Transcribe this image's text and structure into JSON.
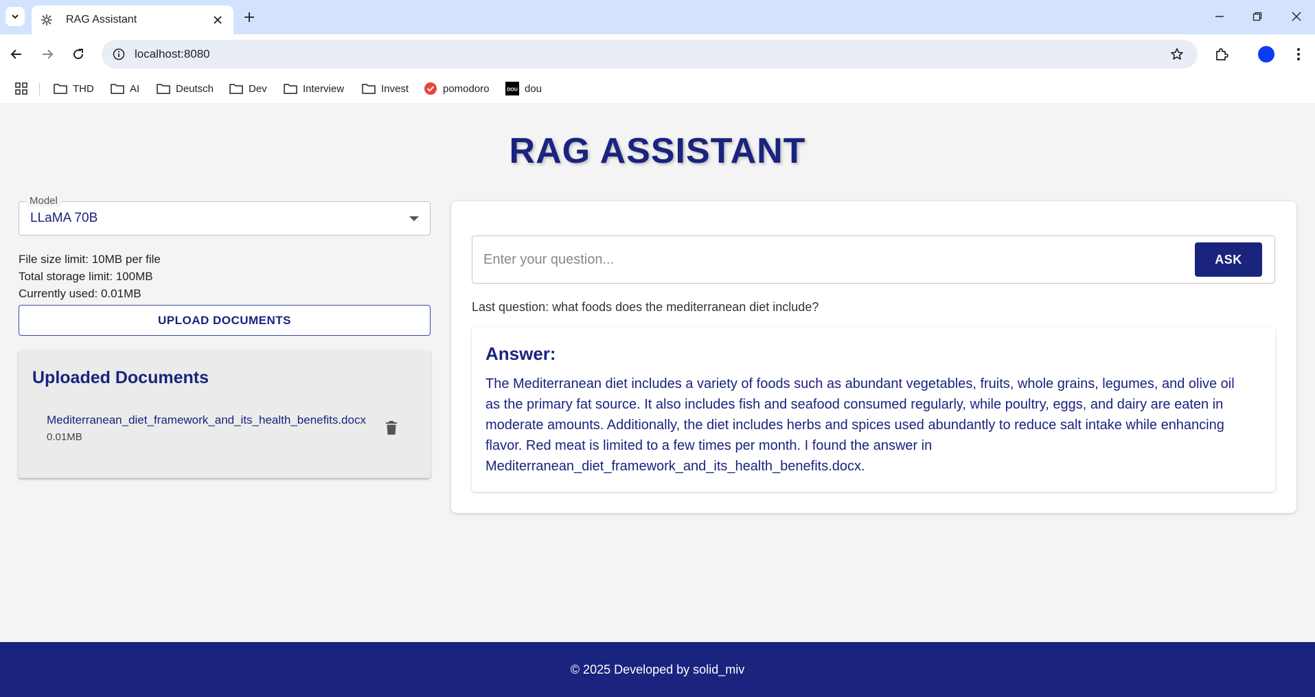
{
  "browser": {
    "tab_title": "RAG Assistant",
    "url": "localhost:8080",
    "bookmarks": [
      {
        "label": "THD",
        "icon": "folder-icon"
      },
      {
        "label": "AI",
        "icon": "folder-icon"
      },
      {
        "label": "Deutsch",
        "icon": "folder-icon"
      },
      {
        "label": "Dev",
        "icon": "folder-icon"
      },
      {
        "label": "Interview",
        "icon": "folder-icon"
      },
      {
        "label": "Invest",
        "icon": "folder-icon"
      },
      {
        "label": "pomodoro",
        "icon": "pomodoro-icon"
      },
      {
        "label": "dou",
        "icon": "dou-icon"
      }
    ],
    "dou_icon_text": "DOU",
    "profile_color": "#0b3bf4"
  },
  "app": {
    "title": "RAG ASSISTANT",
    "model": {
      "label": "Model",
      "value": "LLaMA 70B"
    },
    "limits": {
      "file_size": "File size limit: 10MB per file",
      "total_storage": "Total storage limit: 100MB",
      "used": "Currently used: 0.01MB"
    },
    "upload_label": "UPLOAD DOCUMENTS",
    "documents": {
      "title": "Uploaded Documents",
      "items": [
        {
          "name": "Mediterranean_diet_framework_and_its_health_benefits.docx",
          "size": "0.01MB"
        }
      ]
    },
    "question": {
      "placeholder": "Enter your question...",
      "value": "",
      "ask_label": "ASK"
    },
    "last_question": "Last question: what foods does the mediterranean diet include?",
    "answer": {
      "heading": "Answer:",
      "text": "The Mediterranean diet includes a variety of foods such as abundant vegetables, fruits, whole grains, legumes, and olive oil as the primary fat source. It also includes fish and seafood consumed regularly, while poultry, eggs, and dairy are eaten in moderate amounts. Additionally, the diet includes herbs and spices used abundantly to reduce salt intake while enhancing flavor. Red meat is limited to a few times per month. I found the answer in Mediterranean_diet_framework_and_its_health_benefits.docx."
    },
    "footer": "© 2025 Developed by solid_miv",
    "colors": {
      "primary": "#1a237e",
      "background": "#f4f4f4",
      "delete_icon": "#555555"
    }
  }
}
